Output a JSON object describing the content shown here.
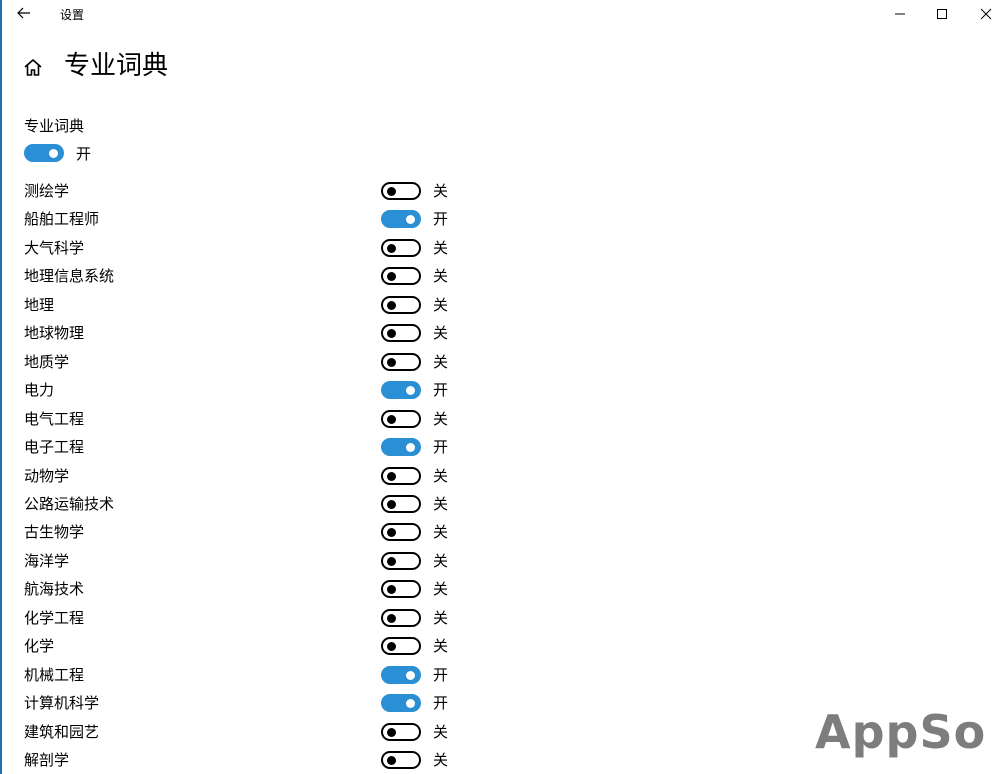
{
  "window": {
    "title": "设置"
  },
  "page": {
    "title": "专业词典"
  },
  "master": {
    "label": "专业词典",
    "state": "开",
    "on": true
  },
  "rows": [
    {
      "label": "测绘学",
      "on": false,
      "state": "关"
    },
    {
      "label": "船舶工程师",
      "on": true,
      "state": "开"
    },
    {
      "label": "大气科学",
      "on": false,
      "state": "关"
    },
    {
      "label": "地理信息系统",
      "on": false,
      "state": "关"
    },
    {
      "label": "地理",
      "on": false,
      "state": "关"
    },
    {
      "label": "地球物理",
      "on": false,
      "state": "关"
    },
    {
      "label": "地质学",
      "on": false,
      "state": "关"
    },
    {
      "label": "电力",
      "on": true,
      "state": "开"
    },
    {
      "label": "电气工程",
      "on": false,
      "state": "关"
    },
    {
      "label": "电子工程",
      "on": true,
      "state": "开"
    },
    {
      "label": "动物学",
      "on": false,
      "state": "关"
    },
    {
      "label": "公路运输技术",
      "on": false,
      "state": "关"
    },
    {
      "label": "古生物学",
      "on": false,
      "state": "关"
    },
    {
      "label": "海洋学",
      "on": false,
      "state": "关"
    },
    {
      "label": "航海技术",
      "on": false,
      "state": "关"
    },
    {
      "label": "化学工程",
      "on": false,
      "state": "关"
    },
    {
      "label": "化学",
      "on": false,
      "state": "关"
    },
    {
      "label": "机械工程",
      "on": true,
      "state": "开"
    },
    {
      "label": "计算机科学",
      "on": true,
      "state": "开"
    },
    {
      "label": "建筑和园艺",
      "on": false,
      "state": "关"
    },
    {
      "label": "解剖学",
      "on": false,
      "state": "关"
    }
  ],
  "watermark": {
    "text": "AppSo"
  },
  "colors": {
    "accent": "#2a8fd4",
    "watermark": "#7d7d7d"
  },
  "icons": [
    "back-arrow-icon",
    "minimize-icon",
    "maximize-icon",
    "close-icon",
    "home-icon"
  ]
}
